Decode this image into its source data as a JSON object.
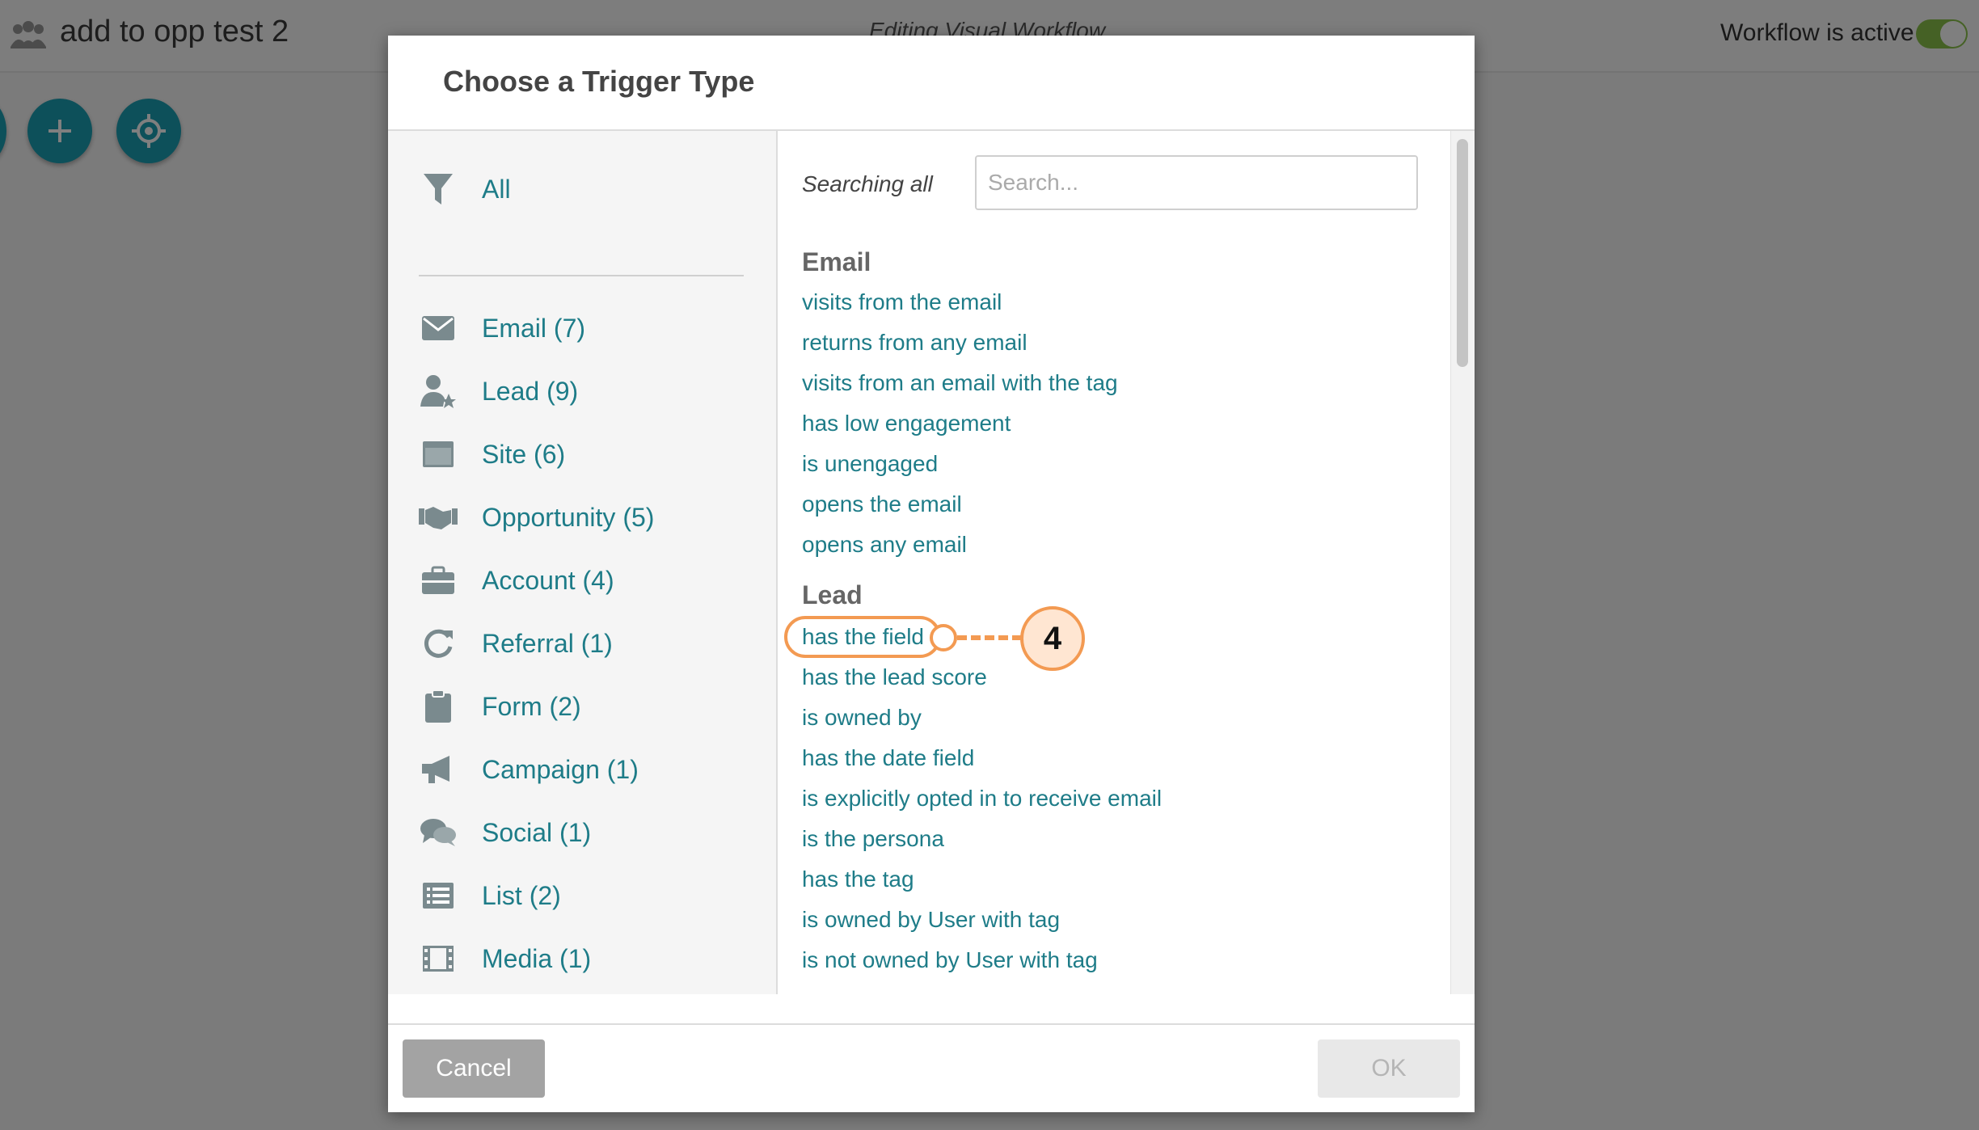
{
  "app": {
    "title": "add to opp test 2",
    "editing_label": "Editing Visual Workflow",
    "workflow_status": "Workflow is active"
  },
  "modal": {
    "title": "Choose a Trigger Type",
    "categories": [
      {
        "label": "All",
        "icon": "filter-icon"
      },
      {
        "label": "Email (7)",
        "icon": "envelope-icon"
      },
      {
        "label": "Lead (9)",
        "icon": "user-star-icon"
      },
      {
        "label": "Site (6)",
        "icon": "browser-window-icon"
      },
      {
        "label": "Opportunity (5)",
        "icon": "handshake-icon"
      },
      {
        "label": "Account (4)",
        "icon": "briefcase-icon"
      },
      {
        "label": "Referral (1)",
        "icon": "refresh-icon"
      },
      {
        "label": "Form (2)",
        "icon": "clipboard-icon"
      },
      {
        "label": "Campaign (1)",
        "icon": "megaphone-icon"
      },
      {
        "label": "Social (1)",
        "icon": "chat-bubbles-icon"
      },
      {
        "label": "List (2)",
        "icon": "list-icon"
      },
      {
        "label": "Media (1)",
        "icon": "film-icon"
      }
    ],
    "search": {
      "label": "Searching all",
      "placeholder": "Search..."
    },
    "groups": [
      {
        "name": "Email",
        "items": [
          "visits from the email",
          "returns from any email",
          "visits from an email with the tag",
          "has low engagement",
          "is unengaged",
          "opens the email",
          "opens any email"
        ]
      },
      {
        "name": "Lead",
        "items": [
          "has the field",
          "has the lead score",
          "is owned by",
          "has the date field",
          "is explicitly opted in to receive email",
          "is the persona",
          "has the tag",
          "is owned by User with tag",
          "is not owned by User with tag"
        ]
      }
    ],
    "callout_number": "4",
    "cancel_label": "Cancel",
    "ok_label": "OK"
  },
  "colors": {
    "link": "#1e7c88",
    "accent": "#1aa0b4",
    "callout": "#f39a52",
    "toggle_on": "#8bc34a"
  }
}
